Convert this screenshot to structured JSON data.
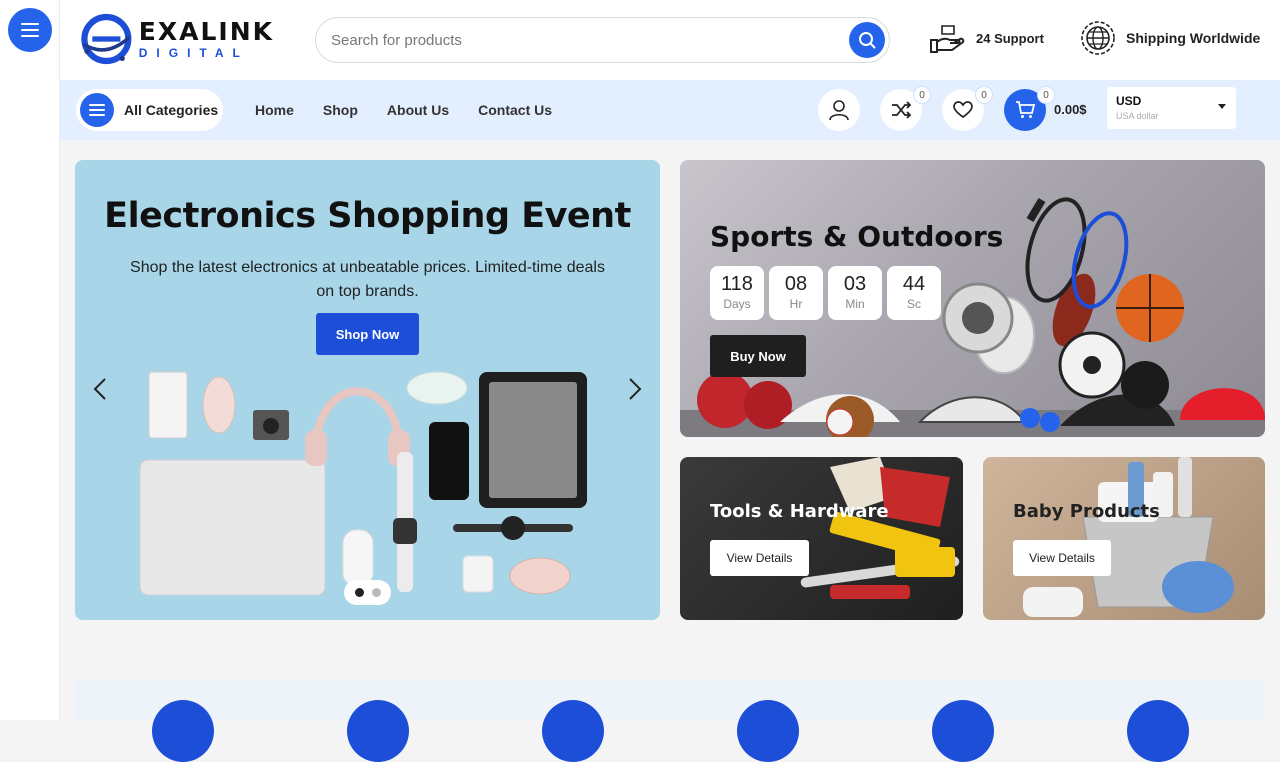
{
  "header": {
    "logo_main": "EXALINK",
    "logo_sub": "DIGITAL",
    "search_placeholder": "Search for products",
    "support_label": "24 Support",
    "shipping_label": "Shipping Worldwide"
  },
  "nav": {
    "all_categories": "All Categories",
    "links": [
      "Home",
      "Shop",
      "About Us",
      "Contact Us"
    ],
    "compare_count": "0",
    "wishlist_count": "0",
    "cart_count": "0",
    "cart_total": "0.00$",
    "currency_code": "USD",
    "currency_name": "USA dollar"
  },
  "hero": {
    "title": "Electronics Shopping Event",
    "description": "Shop the latest electronics at unbeatable prices. Limited-time deals on top brands.",
    "button": "Shop Now"
  },
  "sports": {
    "title": "Sports & Outdoors",
    "countdown": [
      {
        "value": "118",
        "unit": "Days"
      },
      {
        "value": "08",
        "unit": "Hr"
      },
      {
        "value": "03",
        "unit": "Min"
      },
      {
        "value": "44",
        "unit": "Sc"
      }
    ],
    "button": "Buy Now"
  },
  "tools": {
    "title": "Tools & Hardware",
    "button": "View Details"
  },
  "baby": {
    "title": "Baby Products",
    "button": "View Details"
  },
  "colors": {
    "accent": "#2563eb",
    "nav_bg": "#e3efff",
    "hero_bg": "#a8d6e8"
  }
}
